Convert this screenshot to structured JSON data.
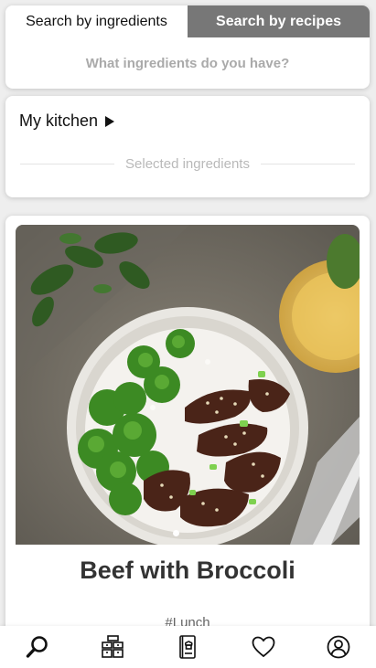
{
  "search": {
    "tabs": [
      {
        "label": "Search by ingredients",
        "active": true
      },
      {
        "label": "Search by recipes",
        "active": false
      }
    ],
    "placeholder": "What ingredients do you have?"
  },
  "kitchen": {
    "title": "My kitchen",
    "selected_label": "Selected ingredients"
  },
  "recipe": {
    "title": "Beef with Broccoli",
    "tag": "#Lunch"
  },
  "bottom_nav": {
    "items": [
      {
        "icon": "search-icon"
      },
      {
        "icon": "kitchen-icon"
      },
      {
        "icon": "recipe-book-icon"
      },
      {
        "icon": "heart-icon"
      },
      {
        "icon": "profile-icon"
      }
    ]
  },
  "colors": {
    "inactive_tab": "#777777",
    "page_background": "#eeeeee",
    "placeholder": "#aaaaaa"
  }
}
